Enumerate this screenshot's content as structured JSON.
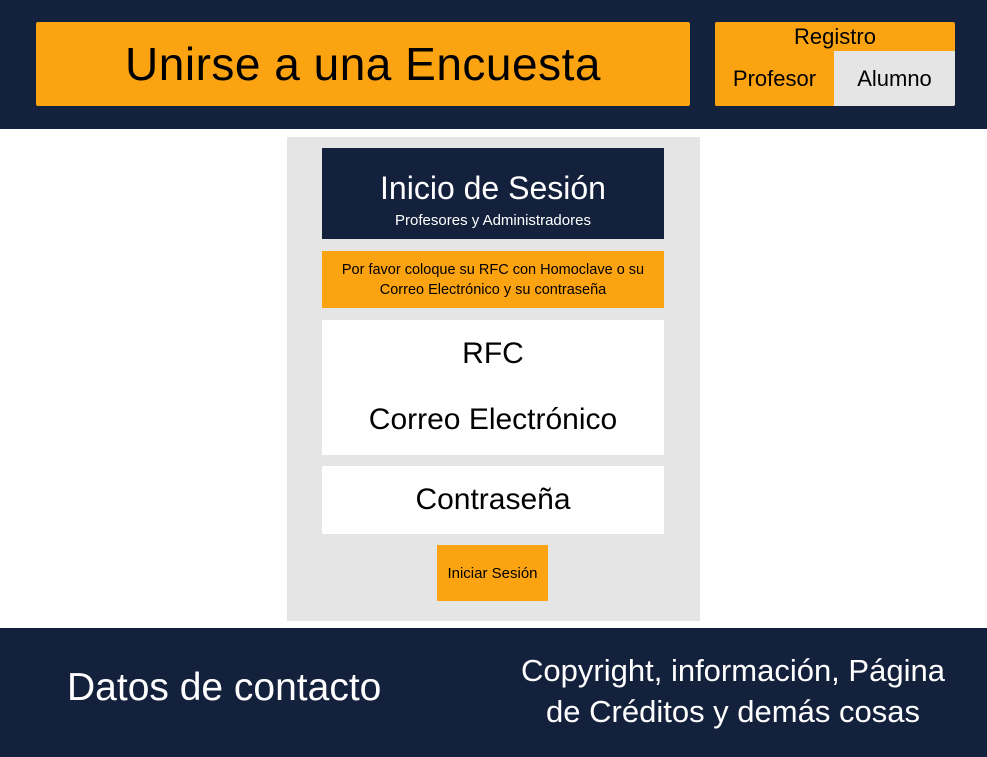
{
  "header": {
    "join_survey_label": "Unirse a una Encuesta",
    "registro": {
      "title": "Registro",
      "options": [
        "Profesor",
        "Alumno"
      ]
    }
  },
  "login": {
    "title": "Inicio de Sesión",
    "subtitle": "Profesores y Administradores",
    "instructions_line1": "Por favor coloque su RFC con Homoclave o su",
    "instructions_line2": "Correo Electrónico y su contraseña",
    "identifier_field": {
      "line1": "RFC",
      "line2": "Correo Electrónico"
    },
    "password_field": "Contraseña",
    "submit_label": "Iniciar Sesión"
  },
  "footer": {
    "contact": "Datos de contacto",
    "copyright_line1": "Copyright, información, Página",
    "copyright_line2": "de Créditos  y demás cosas"
  },
  "colors": {
    "navy": "#14213d",
    "orange": "#fca311",
    "light_gray": "#e5e5e5",
    "white": "#ffffff"
  }
}
